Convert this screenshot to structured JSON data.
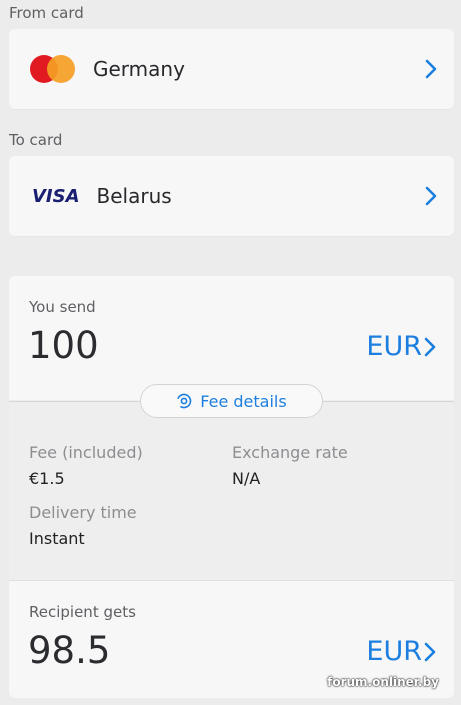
{
  "from": {
    "label": "From card",
    "card_brand": "mastercard",
    "card_name": "Germany",
    "chevron_icon": "chevron-right-icon"
  },
  "to": {
    "label": "To card",
    "card_brand": "VISA",
    "card_name": "Belarus",
    "chevron_icon": "chevron-right-icon"
  },
  "send": {
    "label": "You send",
    "amount": "100",
    "currency": "EUR"
  },
  "fee_button": {
    "label": "Fee details",
    "icon": "fee-icon"
  },
  "details": {
    "fee_label": "Fee (included)",
    "fee_value": "€1.5",
    "rate_label": "Exchange rate",
    "rate_value": "N/A",
    "delivery_label": "Delivery time",
    "delivery_value": "Instant"
  },
  "receive": {
    "label": "Recipient gets",
    "amount": "98.5",
    "currency": "EUR"
  },
  "watermark": "forum.onliner.by",
  "colors": {
    "accent": "#1c7fe0",
    "background": "#ececec",
    "card": "#f7f7f7",
    "mastercard_red": "#e11a22",
    "mastercard_orange": "#f59e24",
    "visa_blue": "#1a1f71"
  }
}
